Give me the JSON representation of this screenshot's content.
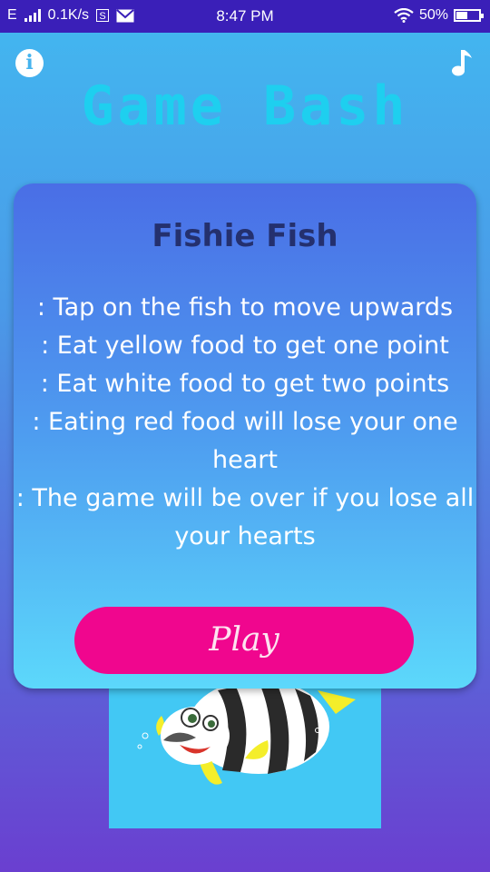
{
  "status_bar": {
    "carrier": "E",
    "net_speed": "0.1K/s",
    "s_badge": "S",
    "time": "8:47 PM",
    "battery_percent": "50%",
    "battery_level": 0.5
  },
  "header": {
    "info_icon": "info-icon",
    "info_glyph": "i",
    "music_icon": "music-note-icon",
    "title": "Game  Bash"
  },
  "card": {
    "title": "Fishie Fish",
    "rules": [
      ": Tap on the fish to move upwards",
      ": Eat yellow food to get one point",
      ": Eat white food to get two points",
      ": Eating red food will lose your one heart",
      ": The game will be over if you lose all your hearts"
    ],
    "play_label": "Play"
  },
  "colors": {
    "status_bar": "#3a1fb8",
    "title_cyan": "#1ad3f0",
    "play_pink": "#f0068e",
    "card_title": "#24306e"
  }
}
